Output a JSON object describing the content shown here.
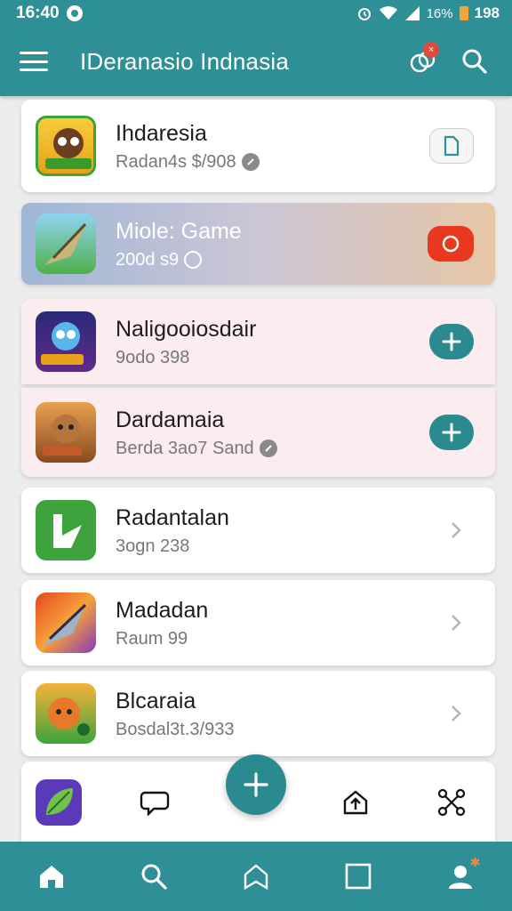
{
  "status_bar": {
    "time": "16:40",
    "battery_text": "16%",
    "time_right": "198"
  },
  "app_bar": {
    "title": "IDeranasio Indnasia",
    "notification_badge": "×"
  },
  "items": [
    {
      "title": "Ihdaresia",
      "subtitle": "Radan4s $/908",
      "style": "plain",
      "action": "doc"
    },
    {
      "title": "Miole: Game",
      "subtitle": "200d s9",
      "style": "featured",
      "action": "record"
    },
    {
      "title": "Naligooiosdair",
      "subtitle": "9odo 398",
      "style": "pink",
      "action": "add"
    },
    {
      "title": "Dardamaia",
      "subtitle": "Berda 3ao7 Sand",
      "style": "pink",
      "action": "add"
    },
    {
      "title": "Radantalan",
      "subtitle": "3ogn 238",
      "style": "plain",
      "action": "chevron"
    },
    {
      "title": "Madadan",
      "subtitle": "Raum 99",
      "style": "plain",
      "action": "chevron"
    },
    {
      "title": "Blcaraia",
      "subtitle": "Bosdal3t.3/933",
      "style": "plain",
      "action": "chevron"
    }
  ],
  "icons": {
    "toolbar": [
      "leaf-app-icon",
      "chat-bubble-icon",
      "add-icon",
      "home-upload-icon",
      "share-network-icon"
    ],
    "bottom_nav": [
      "home-icon",
      "search-icon",
      "bookmark-house-icon",
      "square-icon",
      "profile-icon"
    ]
  },
  "colors": {
    "primary": "#2f8f96",
    "accent_red": "#e8391f",
    "badge": "#e14b3e"
  }
}
